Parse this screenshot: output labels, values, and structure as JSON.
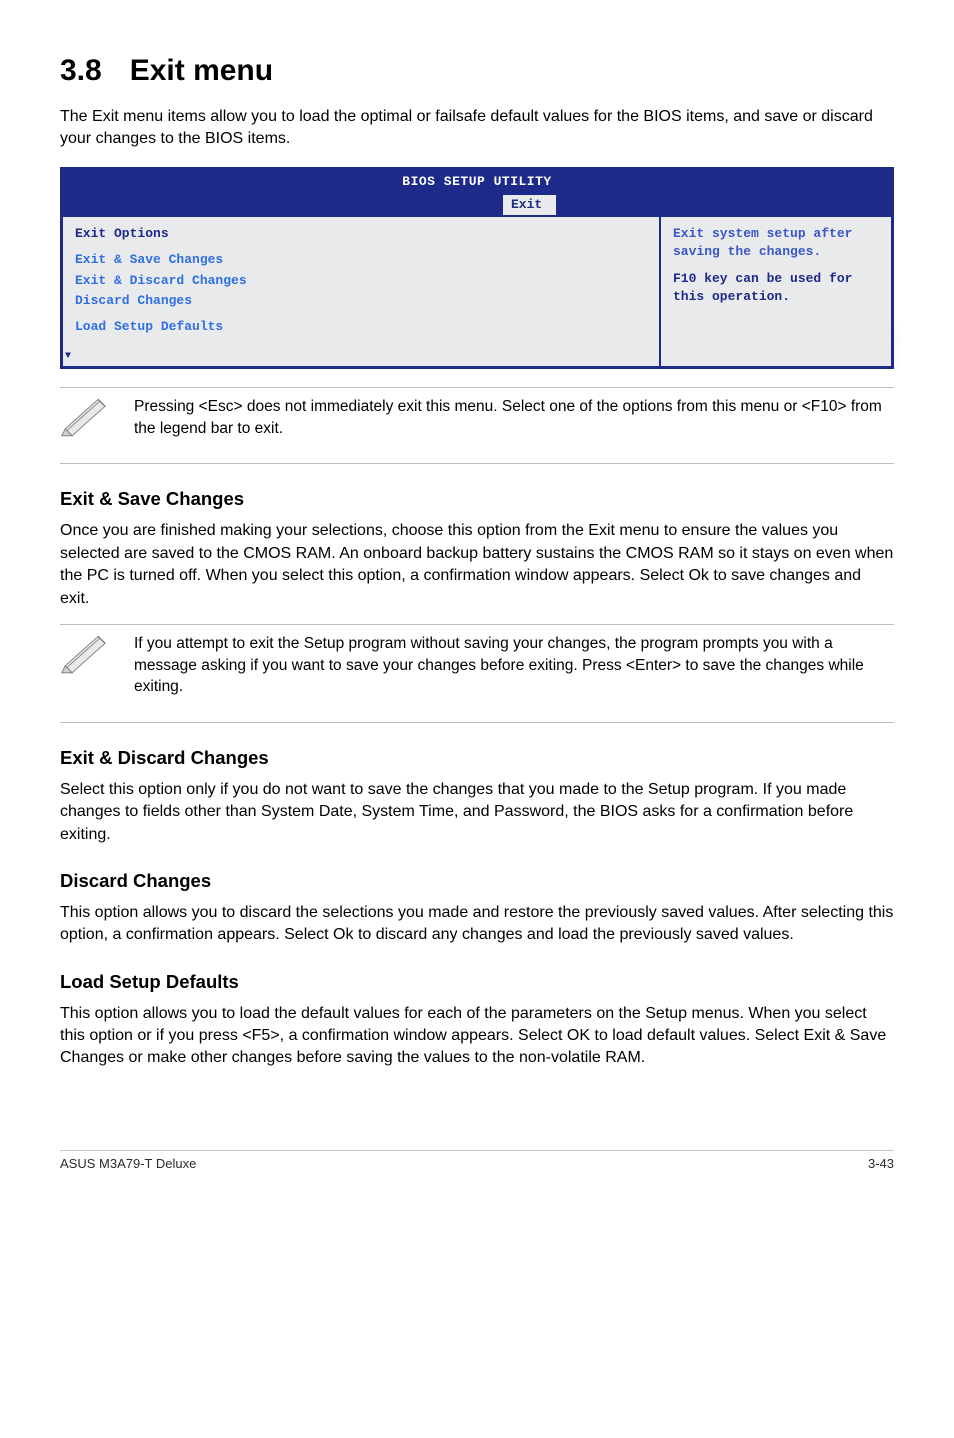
{
  "heading": {
    "num": "3.8",
    "title": "Exit menu"
  },
  "intro": "The Exit menu items allow you to load the optimal or failsafe default values for the BIOS items, and save or discard your changes to the BIOS items.",
  "bios": {
    "title": "BIOS SETUP UTILITY",
    "tab": "Exit",
    "left_heading": "Exit Options",
    "items": [
      "Exit & Save Changes",
      "Exit & Discard Changes",
      "Discard Changes",
      "Load Setup Defaults"
    ],
    "help_line1": "Exit system setup after saving the changes.",
    "help_line2": "F10 key can be used for this operation."
  },
  "note1": "Pressing <Esc> does not immediately exit this menu. Select one of the options from this menu or <F10> from the legend bar to exit.",
  "sec1": {
    "h": "Exit & Save Changes",
    "p": "Once you are finished making your selections, choose this option from the Exit menu to ensure the values you selected are saved to the CMOS RAM. An onboard backup battery sustains the CMOS RAM so it stays on even when the PC is turned off. When you select this option, a confirmation window appears. Select Ok to save changes and exit."
  },
  "note2": "If you attempt to exit the Setup program without saving your changes, the program prompts you with a message asking if you want to save your changes before exiting. Press <Enter> to save the  changes while exiting.",
  "sec2": {
    "h": "Exit & Discard Changes",
    "p": "Select this option only if you do not want to save the changes that you  made to the Setup program. If you made changes to fields other than System Date, System Time, and Password, the BIOS asks for a confirmation before exiting."
  },
  "sec3": {
    "h": "Discard Changes",
    "p": "This option allows you to discard the selections you made and restore the previously saved values. After selecting this option, a confirmation appears. Select Ok to discard any changes and load the previously saved values."
  },
  "sec4": {
    "h": "Load Setup Defaults",
    "p": "This option allows you to load the default values for each of the parameters on the Setup menus. When you select this option or if you press <F5>, a confirmation window appears. Select OK to load default values. Select Exit & Save Changes or make other changes before saving the values to the non-volatile RAM."
  },
  "footer": {
    "left": "ASUS M3A79-T Deluxe",
    "right": "3-43"
  }
}
